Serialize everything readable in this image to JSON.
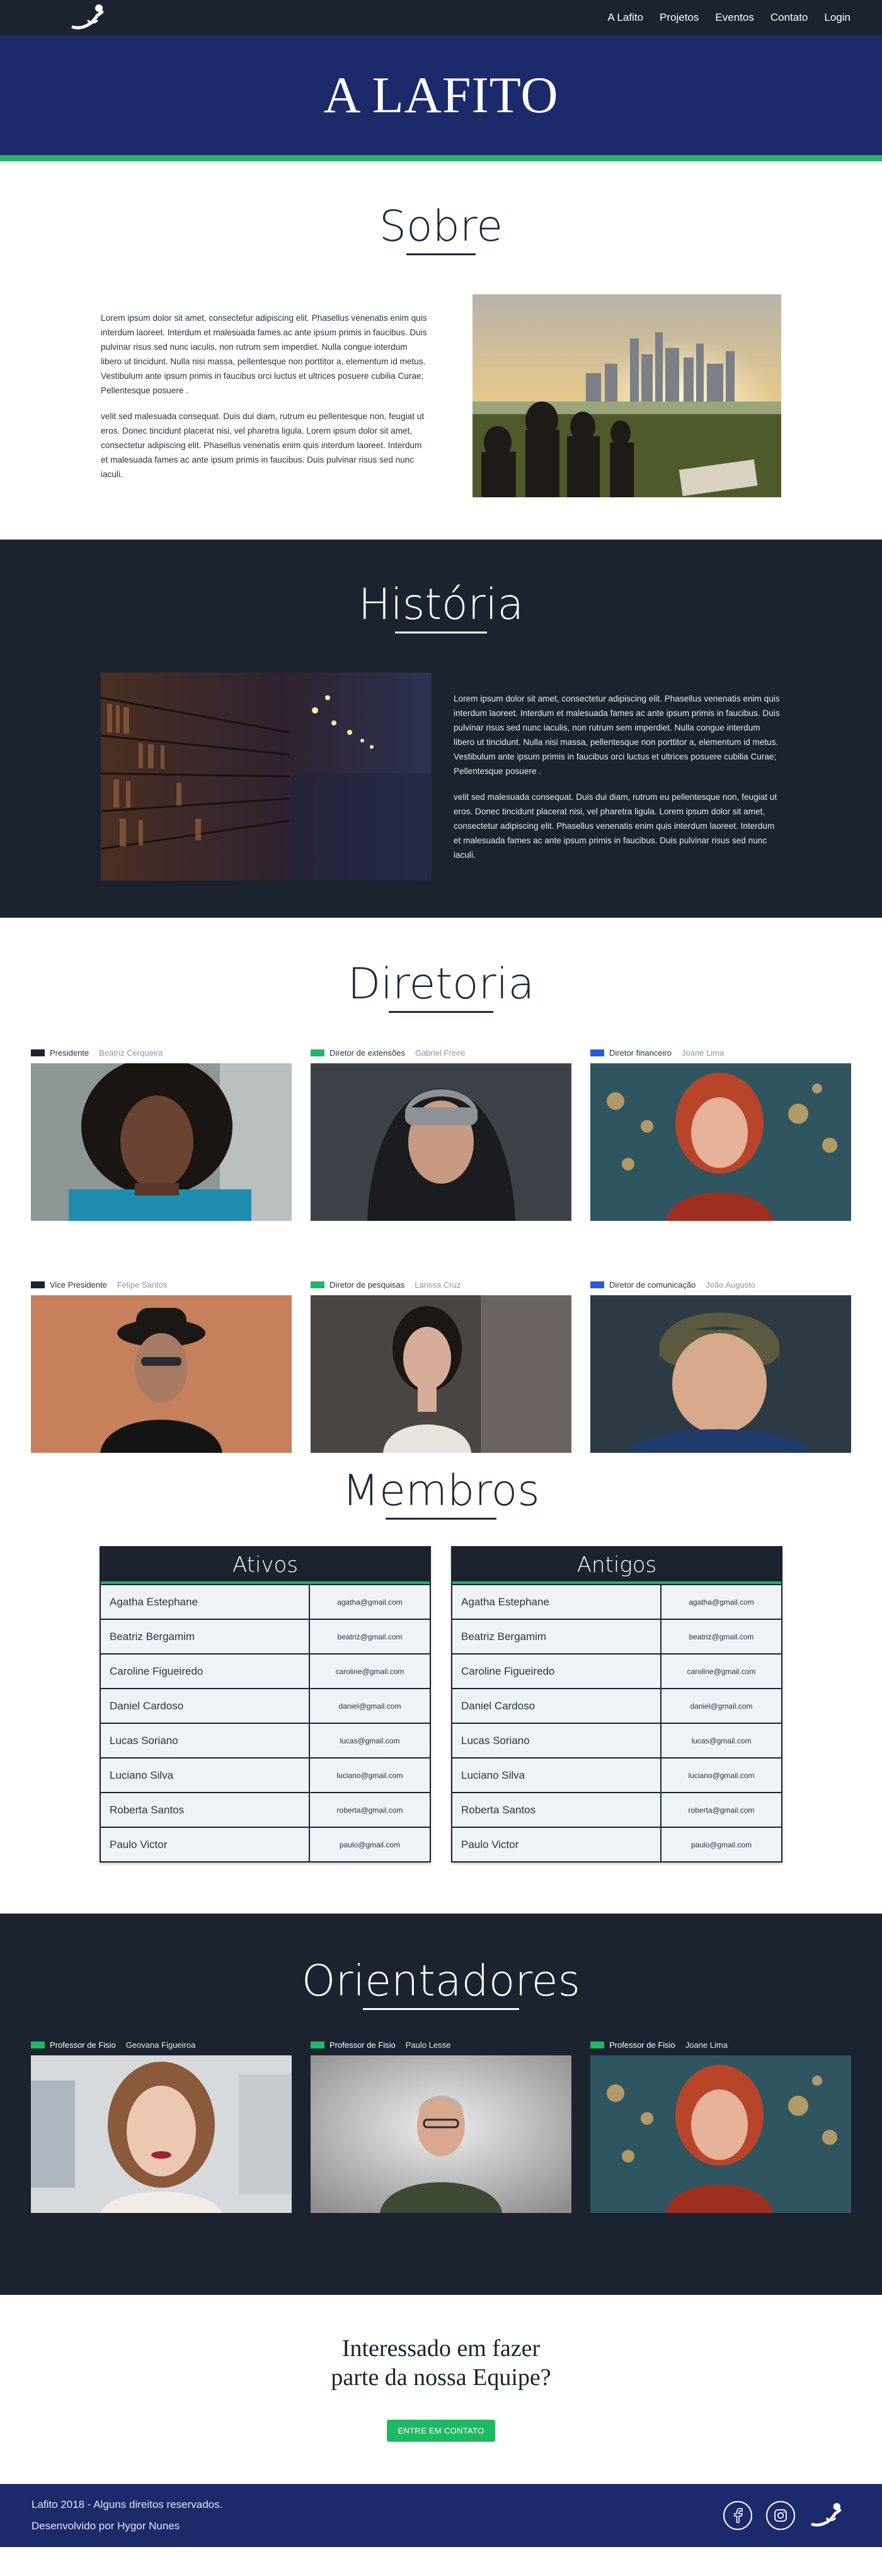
{
  "nav": {
    "links": [
      "A Lafito",
      "Projetos",
      "Eventos",
      "Contato",
      "Login"
    ]
  },
  "hero": {
    "title": "A LAFITO"
  },
  "sobre": {
    "title": "Sobre",
    "paragraph1": "Lorem ipsum dolor sit amet, consectetur adipiscing elit. Phasellus venenatis enim quis interdum laoreet. Interdum et malesuada fames ac ante ipsum primis in faucibus. Duis pulvinar risus sed nunc iaculis, non rutrum sem imperdiet. Nulla congue interdum libero ut tincidunt. Nulla nisi massa, pellentesque non porttitor a, elementum id metus. Vestibulum ante ipsum primis in faucibus orci luctus et ultrices posuere cubilia Curae; Pellentesque posuere .",
    "paragraph2": "velit sed malesuada consequat. Duis dui diam, rutrum eu pellentesque non, feugiat ut eros. Donec tincidunt placerat nisi, vel pharetra ligula. Lorem ipsum dolor sit amet, consectetur adipiscing elit. Phasellus venenatis enim quis interdum laoreet. Interdum et malesuada fames ac ante ipsum primis in faucibus. Duis pulvinar risus sed nunc iaculi."
  },
  "historia": {
    "title": "História",
    "paragraph1": "Lorem ipsum dolor sit amet, consectetur adipiscing elit. Phasellus venenatis enim quis interdum laoreet. Interdum et malesuada fames ac ante ipsum primis in faucibus. Duis pulvinar risus sed nunc iaculis, non rutrum sem imperdiet. Nulla congue interdum libero ut tincidunt. Nulla nisi massa, pellentesque non porttitor a, elementum id metus. Vestibulum ante ipsum primis in faucibus orci luctus et ultrices posuere cubilia Curae; Pellentesque posuere .",
    "paragraph2": "velit sed malesuada consequat. Duis dui diam, rutrum eu pellentesque non, feugiat ut eros. Donec tincidunt placerat nisi, vel pharetra ligula. Lorem ipsum dolor sit amet, consectetur adipiscing elit. Phasellus venenatis enim quis interdum laoreet. Interdum et malesuada fames ac ante ipsum primis in faucibus. Duis pulvinar risus sed nunc iaculi."
  },
  "diretoria": {
    "title": "Diretoria",
    "members": [
      {
        "role": "Presidente",
        "name": "Beatriz Cerqueira",
        "flag_color": "#1b2330"
      },
      {
        "role": "Diretor de extensões",
        "name": "Gabriel Freire",
        "flag_color": "#1fb865"
      },
      {
        "role": "Diretor financeiro",
        "name": "Joane Lima",
        "flag_color": "#2a5bd7"
      },
      {
        "role": "Vice Presidente",
        "name": "Felipe Santos",
        "flag_color": "#1b2330"
      },
      {
        "role": "Diretor de pesquisas",
        "name": "Larissa Cruz",
        "flag_color": "#1fb865"
      },
      {
        "role": "Diretor de comunicação",
        "name": "João Augusto",
        "flag_color": "#2a5bd7"
      }
    ]
  },
  "membros": {
    "title": "Membros",
    "ativos": {
      "header": "Ativos",
      "rows": [
        {
          "name": "Agatha Estephane",
          "email": "agatha@gmail.com"
        },
        {
          "name": "Beatriz Bergamim",
          "email": "beatriz@gmail.com"
        },
        {
          "name": "Caroline Figueiredo",
          "email": "caroline@gmail.com"
        },
        {
          "name": "Daniel Cardoso",
          "email": "daniel@gmail.com"
        },
        {
          "name": "Lucas Soriano",
          "email": "lucas@gmail.com"
        },
        {
          "name": "Luciano Silva",
          "email": "luciano@gmail.com"
        },
        {
          "name": "Roberta Santos",
          "email": "roberta@gmail.com"
        },
        {
          "name": "Paulo Victor",
          "email": "paulo@gmail.com"
        }
      ]
    },
    "antigos": {
      "header": "Antigos",
      "rows": [
        {
          "name": "Agatha Estephane",
          "email": "agatha@gmail.com"
        },
        {
          "name": "Beatriz Bergamim",
          "email": "beatriz@gmail.com"
        },
        {
          "name": "Caroline Figueiredo",
          "email": "caroline@gmail.com"
        },
        {
          "name": "Daniel Cardoso",
          "email": "daniel@gmail.com"
        },
        {
          "name": "Lucas Soriano",
          "email": "lucas@gmail.com"
        },
        {
          "name": "Luciano Silva",
          "email": "luciano@gmail.com"
        },
        {
          "name": "Roberta Santos",
          "email": "roberta@gmail.com"
        },
        {
          "name": "Paulo Victor",
          "email": "paulo@gmail.com"
        }
      ]
    }
  },
  "orientadores": {
    "title": "Orientadores",
    "members": [
      {
        "role": "Professor de Fisio",
        "name": "Geovana Figueiroa",
        "flag_color": "#1fb865"
      },
      {
        "role": "Professor de Fisio",
        "name": "Paulo Lesse",
        "flag_color": "#1fb865"
      },
      {
        "role": "Professor de Fisio",
        "name": "Joane Lima",
        "flag_color": "#1fb865"
      }
    ]
  },
  "cta": {
    "line1": "Interessado em fazer",
    "line2": "parte da nossa Equipe?",
    "button": "ENTRE EM CONTATO"
  },
  "footer": {
    "copyright": "Lafito 2018 - Alguns direitos reservados.",
    "credits": "Desenvolvido por Hygor Nunes",
    "icons": [
      "facebook-icon",
      "instagram-icon",
      "lafito-logo-icon"
    ]
  },
  "colors": {
    "navy": "#1b2330",
    "hero_blue": "#1c2a6b",
    "accent_green": "#1fb865",
    "accent_blue": "#2a5bd7"
  }
}
